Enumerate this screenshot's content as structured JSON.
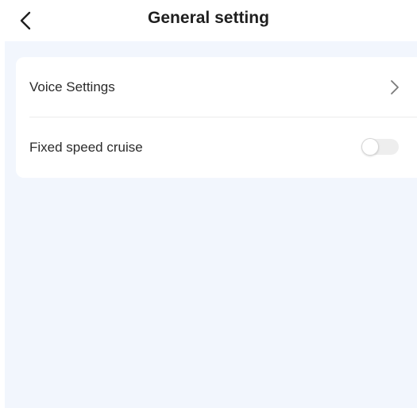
{
  "header": {
    "back_icon": "chevron-left-icon",
    "title": "General setting"
  },
  "settings": {
    "voice": {
      "label": "Voice Settings",
      "icon": "chevron-right-icon"
    },
    "cruise": {
      "label": "Fixed speed cruise",
      "toggle_on": false
    }
  },
  "colors": {
    "background": "#f2f6fd",
    "card": "#ffffff",
    "title_text": "#1f1f1f",
    "label_text": "#2b2b2b",
    "toggle_track_off": "#eeeeee"
  }
}
